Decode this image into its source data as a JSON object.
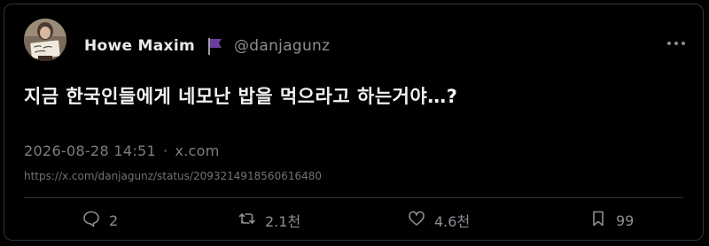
{
  "author": {
    "display_name": "Howe Maxim",
    "handle": "@danjagunz",
    "avatar_icon": "person-holding-sign-avatar",
    "flag_icon": "purple-flag-icon"
  },
  "tweet": {
    "text": "지금 한국인들에게 네모난 밥을 먹으라고 하는거야…?",
    "timestamp": "2026-08-28 14:51",
    "separator": "·",
    "source": "x.com",
    "url": "https://x.com/danjagunz/status/2093214918560616480"
  },
  "actions": {
    "replies": "2",
    "retweets": "2.1천",
    "likes": "4.6천",
    "bookmarks": "99"
  },
  "colors": {
    "background": "#000000",
    "text": "#e7e9ea",
    "muted": "#8b8f94",
    "border": "#2f3336",
    "flag": "#6b3fa0"
  }
}
